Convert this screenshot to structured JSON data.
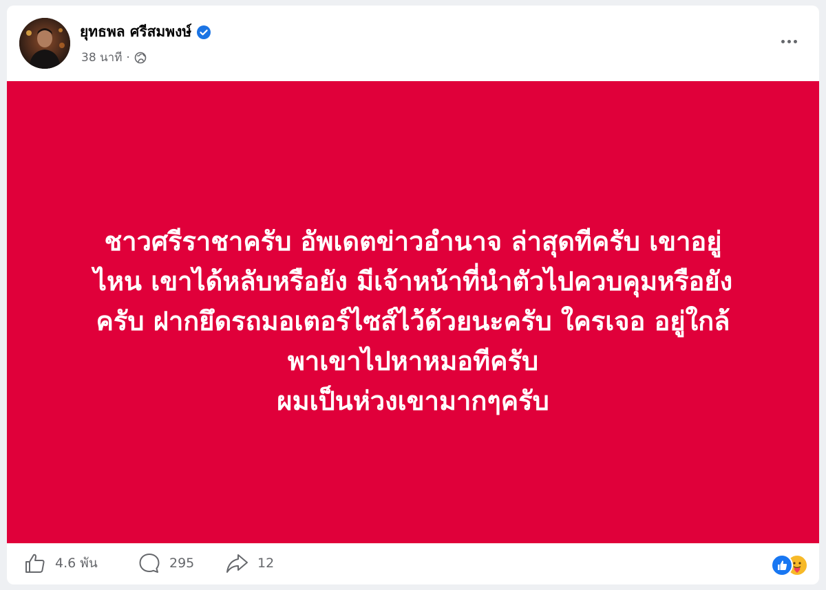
{
  "post": {
    "author": "ยุทธพล ศรีสมพงษ์",
    "verified": true,
    "time": "38 นาที",
    "separator": "·",
    "privacy_icon": "globe-icon",
    "more_icon": "more-horizontal-icon"
  },
  "image": {
    "background_color": "#e0003a",
    "text_color": "#ffffff",
    "lines": [
      "ชาวศรีราชาครับ อัพเดตข่าวอำนาจ ล่าสุดทีครับ เขาอยู่",
      "ไหน เขาได้หลับหรือยัง มีเจ้าหน้าที่นำตัวไปควบคุมหรือยัง",
      "ครับ ฝากยึดรถมอเตอร์ไซส์ไว้ด้วยนะครับ ใครเจอ อยู่ใกล้",
      "พาเขาไปหาหมอทีครับ",
      "ผมเป็นห่วงเขามากๆครับ"
    ]
  },
  "footer": {
    "likes": "4.6 พัน",
    "comments": "295",
    "shares": "12",
    "reactions": [
      "like-reaction-icon",
      "care-reaction-icon"
    ]
  },
  "colors": {
    "accent": "#1877f2",
    "muted_text": "#65676b",
    "verified": "#1b74e4"
  }
}
